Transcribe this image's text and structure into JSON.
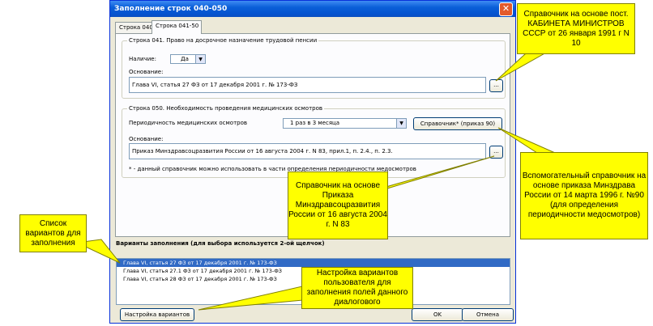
{
  "window": {
    "title": "Заполнение строк 040-050",
    "close_glyph": "✕"
  },
  "tabs": [
    {
      "label": "Строка 040",
      "active": false
    },
    {
      "label": "Строка 041-50",
      "active": true
    }
  ],
  "row041": {
    "group_title": "Строка 041. Право на досрочное назначение трудовой пенсии",
    "presence_label": "Наличие:",
    "presence_value": "Да",
    "basis_label": "Основание:",
    "basis_value": "Глава VI, статья 27 ФЗ от 17 декабря 2001 г. № 173-ФЗ",
    "browse_label": "..."
  },
  "row050": {
    "group_title": "Строка 050. Необходимость проведения медицинских осмотров",
    "periodicity_label": "Периодичность медицинских осмотров",
    "periodicity_value": "1 раз в 3 месяца",
    "directory_button": "Справочник* (приказ 90)",
    "basis_label": "Основание:",
    "basis_value": "Приказ Минздравсоцразвития России от 16 августа 2004 г. N 83, прил.1, п. 2.4., п. 2.3.",
    "browse_label": "...",
    "footnote": "* - данный справочник можно использовать в части  определения периодичности медосмотров"
  },
  "variants": {
    "label": "Варианты заполнения (для выбора используется 2-ой щелчок)",
    "items": [
      "Глава VI, статья 27 ФЗ от 17 декабря 2001 г. № 173-ФЗ",
      "Глава VI, статья 27.1 ФЗ от 17 декабря 2001 г. № 173-ФЗ",
      "Глава VI, статья 28 ФЗ от 17 декабря 2001 г. № 173-ФЗ"
    ],
    "selected_index": 0
  },
  "buttons": {
    "settings": "Настройка вариантов",
    "ok": "OK",
    "cancel": "Отмена"
  },
  "callouts": {
    "c1": "Справочник на основе пост. КАБИНЕТА МИНИСТРОВ СССР от 26 января 1991 г N 10",
    "c2": "Вспомогательный справочник на основе приказа Минздрава России от 14 марта 1996 г. №90 (для определения периодичности медосмотров)",
    "c3": "Справочник на основе Приказа Минздравсоцразвития России от 16 августа 2004 г. N 83",
    "c4": "Список вариантов для заполнения",
    "c5": "Настройка вариантов пользователя для заполнения полей данного диалогового"
  },
  "colors": {
    "callout_fill": "#ffff00",
    "titlebar": "#0a5fd8",
    "selection": "#316ac5"
  }
}
